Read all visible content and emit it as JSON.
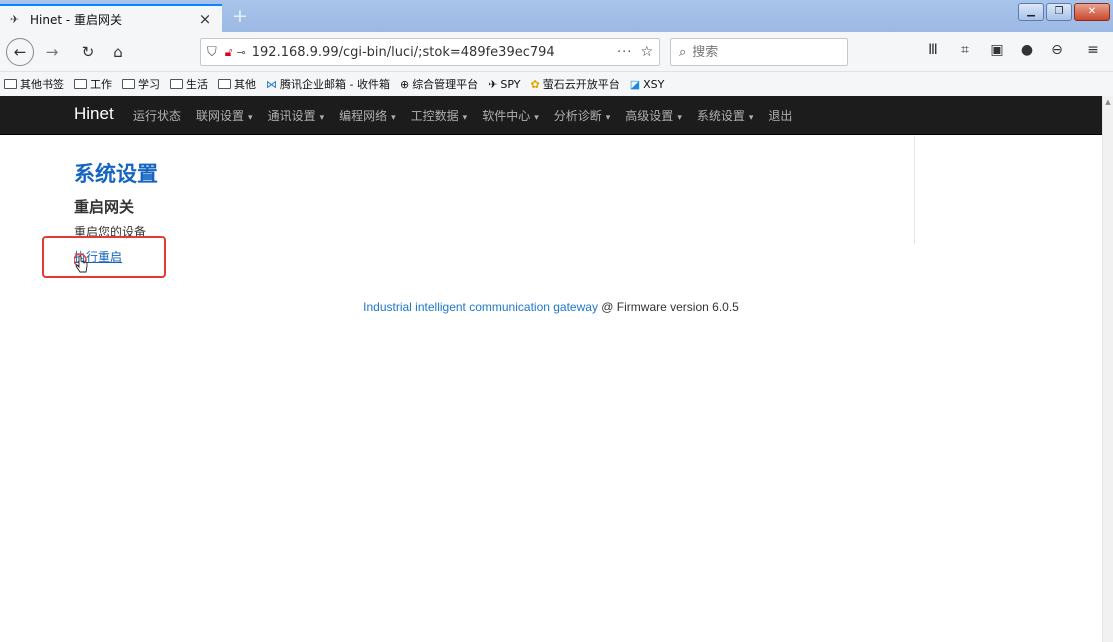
{
  "browser": {
    "tab": {
      "title": "Hinet - 重启网关",
      "favicon_icon": "hinet-favicon-icon"
    },
    "url": "192.168.9.99/cgi-bin/luci/;stok=489fe39ec794",
    "search_placeholder": "搜索",
    "icons": [
      "back-arrow-icon",
      "forward-arrow-icon",
      "reload-icon",
      "home-icon",
      "shield-icon",
      "insecure-lock-icon",
      "key-icon",
      "more-icon",
      "star-icon",
      "search-icon",
      "library-icon",
      "screenshot-icon",
      "reader-icon",
      "chat-icon",
      "account-icon",
      "menu-icon"
    ],
    "bookmarks": [
      {
        "label": "其他书签",
        "icon": "folder-icon"
      },
      {
        "label": "工作",
        "icon": "folder-icon"
      },
      {
        "label": "学习",
        "icon": "folder-icon"
      },
      {
        "label": "生活",
        "icon": "folder-icon"
      },
      {
        "label": "其他",
        "icon": "folder-icon"
      },
      {
        "label": "腾讯企业邮箱 - 收件箱",
        "icon": "tencent-mail-icon"
      },
      {
        "label": "综合管理平台",
        "icon": "globe-icon"
      },
      {
        "label": "SPY",
        "icon": "spy-icon"
      },
      {
        "label": "萤石云开放平台",
        "icon": "ezviz-icon"
      },
      {
        "label": "XSY",
        "icon": "xsy-icon"
      }
    ]
  },
  "site": {
    "brand": "Hinet",
    "menu": [
      {
        "label": "运行状态",
        "dropdown": false
      },
      {
        "label": "联网设置",
        "dropdown": true
      },
      {
        "label": "通讯设置",
        "dropdown": true
      },
      {
        "label": "编程网络",
        "dropdown": true
      },
      {
        "label": "工控数据",
        "dropdown": true
      },
      {
        "label": "软件中心",
        "dropdown": true
      },
      {
        "label": "分析诊断",
        "dropdown": true
      },
      {
        "label": "高级设置",
        "dropdown": true
      },
      {
        "label": "系统设置",
        "dropdown": true
      },
      {
        "label": "退出",
        "dropdown": false
      }
    ]
  },
  "content": {
    "section_title": "系统设置",
    "subtitle": "重启网关",
    "description": "重启您的设备",
    "reboot_link": "执行重启"
  },
  "footer": {
    "link": "Industrial intelligent communication gateway",
    "text": " @ Firmware version 6.0.5"
  },
  "colors": {
    "accent": "#1565c0",
    "nav_bg": "#1c1c1c",
    "highlight": "#e53935"
  }
}
